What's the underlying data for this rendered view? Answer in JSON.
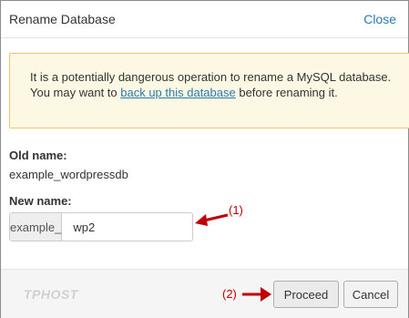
{
  "dialog": {
    "title": "Rename Database",
    "close_label": "Close"
  },
  "warning": {
    "text_before": "It is a potentially dangerous operation to rename a MySQL database. You may want to ",
    "link_text": "back up this database",
    "text_after": " before renaming it."
  },
  "old_name": {
    "label": "Old name:",
    "value": "example_wordpressdb"
  },
  "new_name": {
    "label": "New name:",
    "prefix": "example_",
    "value": "wp2"
  },
  "footer": {
    "brand": "TPHOST",
    "proceed_label": "Proceed",
    "cancel_label": "Cancel"
  },
  "annotations": {
    "step1": "(1)",
    "step2": "(2)",
    "color": "#c00000"
  }
}
